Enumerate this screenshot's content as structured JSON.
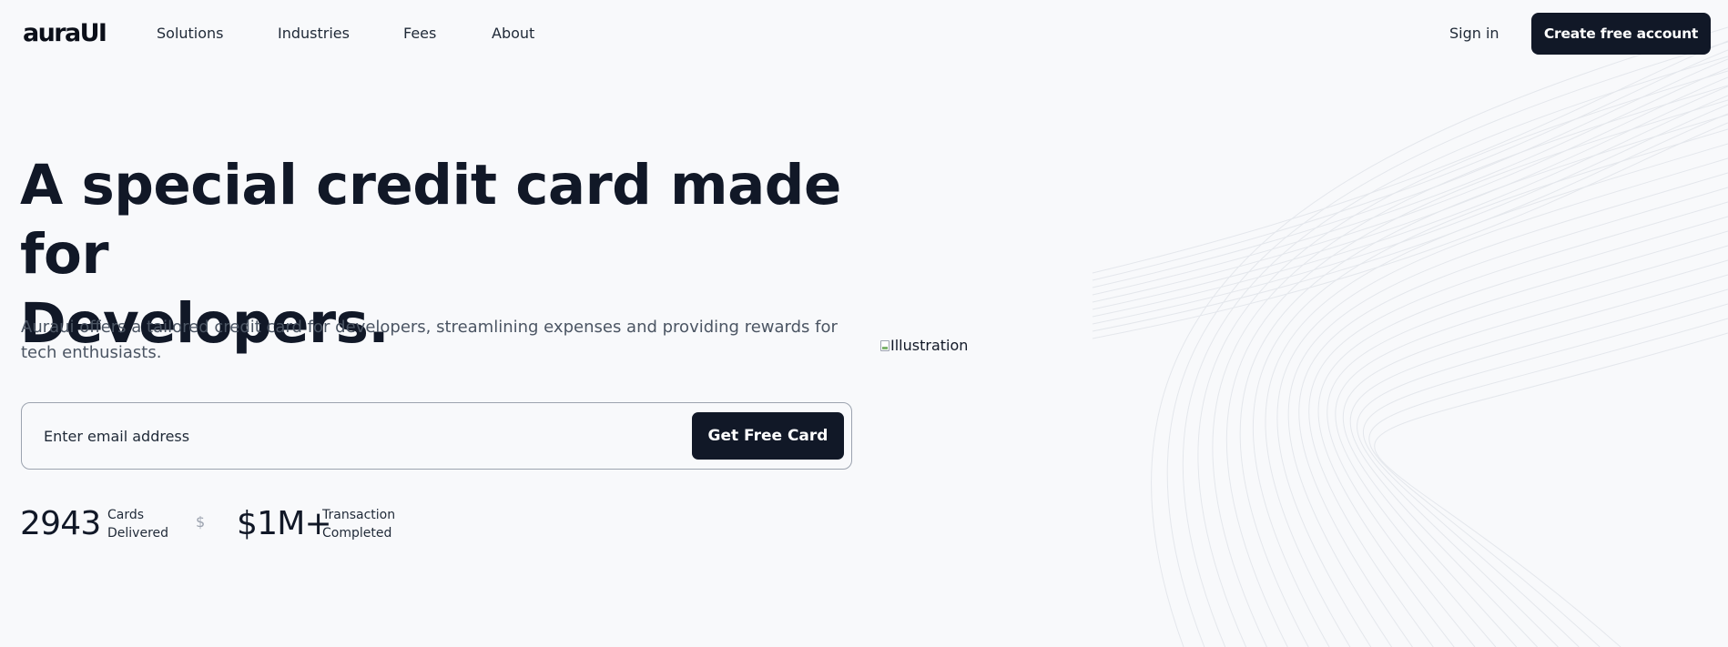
{
  "brand": {
    "logo": "auraUI"
  },
  "nav": {
    "links": [
      "Solutions",
      "Industries",
      "Fees",
      "About"
    ],
    "sign_in": "Sign in",
    "cta": "Create free account"
  },
  "hero": {
    "title_line1": "A special credit card made for",
    "title_line2": "Developers.",
    "description": "Auraui offers a tailored credit card for developers, streamlining expenses and providing rewards for tech enthusiasts.",
    "email_placeholder": "Enter email address",
    "submit": "Get Free Card",
    "illustration_alt": "Illustration"
  },
  "stats": [
    {
      "value": "2943",
      "label_line1": "Cards",
      "label_line2": "Delivered"
    },
    {
      "value": "$1M+",
      "label_line1": "Transaction",
      "label_line2": "Completed"
    }
  ],
  "separator_icon": "$",
  "colors": {
    "background": "#f8f9fb",
    "primary": "#111827",
    "text_muted": "#4b5563",
    "line": "#e5e7eb"
  }
}
